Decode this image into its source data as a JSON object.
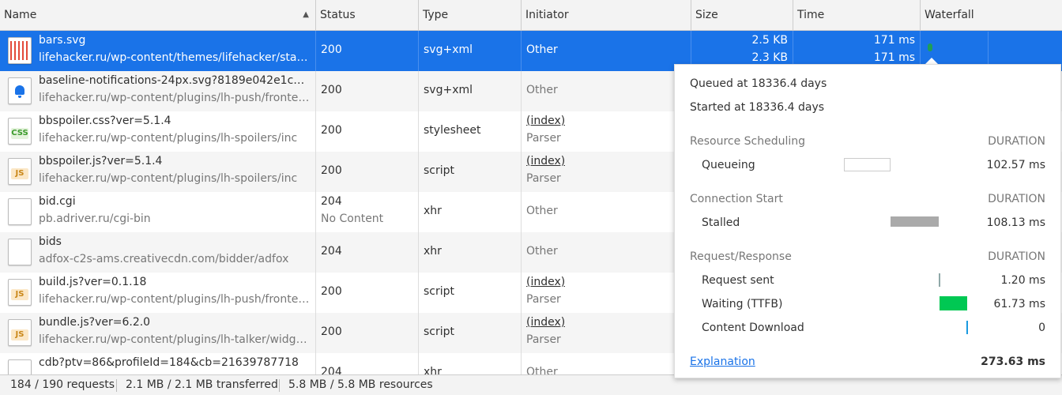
{
  "columns": {
    "name": "Name",
    "status": "Status",
    "type": "Type",
    "initiator": "Initiator",
    "size": "Size",
    "time": "Time",
    "waterfall": "Waterfall"
  },
  "rows": [
    {
      "icon": "svg-bars-icon",
      "name": "bars.svg",
      "path": "lifehacker.ru/wp-content/themes/lifehacker/static/...",
      "status": "200",
      "status_text": "",
      "type": "svg+xml",
      "initiator": "Other",
      "initiator_sub": "",
      "size": "2.5 KB",
      "size_sub": "2.3 KB",
      "time": "171 ms",
      "time_sub": "171 ms"
    },
    {
      "icon": "bell-icon",
      "name": "baseline-notifications-24px.svg?8189e042e1c0fd9...",
      "path": "lifehacker.ru/wp-content/plugins/lh-push/fronten...",
      "status": "200",
      "status_text": "",
      "type": "svg+xml",
      "initiator": "Other",
      "initiator_sub": ""
    },
    {
      "icon": "css-file-icon",
      "icon_text": "CSS",
      "name": "bbspoiler.css?ver=5.1.4",
      "path": "lifehacker.ru/wp-content/plugins/lh-spoilers/inc",
      "status": "200",
      "status_text": "",
      "type": "stylesheet",
      "initiator": "(index)",
      "initiator_sub": "Parser"
    },
    {
      "icon": "js-file-icon",
      "icon_text": "JS",
      "name": "bbspoiler.js?ver=5.1.4",
      "path": "lifehacker.ru/wp-content/plugins/lh-spoilers/inc",
      "status": "200",
      "status_text": "",
      "type": "script",
      "initiator": "(index)",
      "initiator_sub": "Parser"
    },
    {
      "icon": "blank-file-icon",
      "name": "bid.cgi",
      "path": "pb.adriver.ru/cgi-bin",
      "status": "204",
      "status_text": "No Content",
      "type": "xhr",
      "initiator": "Other",
      "initiator_sub": ""
    },
    {
      "icon": "blank-file-icon",
      "name": "bids",
      "path": "adfox-c2s-ams.creativecdn.com/bidder/adfox",
      "status": "204",
      "status_text": "",
      "type": "xhr",
      "initiator": "Other",
      "initiator_sub": ""
    },
    {
      "icon": "js-file-icon",
      "icon_text": "JS",
      "name": "build.js?ver=0.1.18",
      "path": "lifehacker.ru/wp-content/plugins/lh-push/fronten...",
      "status": "200",
      "status_text": "",
      "type": "script",
      "initiator": "(index)",
      "initiator_sub": "Parser"
    },
    {
      "icon": "js-file-icon",
      "icon_text": "JS",
      "name": "bundle.js?ver=6.2.0",
      "path": "lifehacker.ru/wp-content/plugins/lh-talker/widget/...",
      "status": "200",
      "status_text": "",
      "type": "script",
      "initiator": "(index)",
      "initiator_sub": "Parser"
    },
    {
      "icon": "blank-file-icon",
      "name": "cdb?ptv=86&profileId=184&cb=21639787718",
      "path": "",
      "status": "204",
      "status_text": "",
      "type": "xhr",
      "initiator": "Other",
      "initiator_sub": ""
    }
  ],
  "statusbar": {
    "requests": "184 / 190 requests",
    "transferred": "2.1 MB / 2.1 MB transferred",
    "resources": "5.8 MB / 5.8 MB resources"
  },
  "timing": {
    "queued": "Queued at 18336.4 days",
    "started": "Started at 18336.4 days",
    "duration_label": "DURATION",
    "sections": [
      {
        "title": "Resource Scheduling",
        "items": [
          {
            "label": "Queueing",
            "value": "102.57 ms",
            "color": "#ffffff"
          }
        ]
      },
      {
        "title": "Connection Start",
        "items": [
          {
            "label": "Stalled",
            "value": "108.13 ms",
            "color": "#aaaaaa"
          }
        ]
      },
      {
        "title": "Request/Response",
        "items": [
          {
            "label": "Request sent",
            "value": "1.20 ms",
            "color": "#8fa8a8"
          },
          {
            "label": "Waiting (TTFB)",
            "value": "61.73 ms",
            "color": "#00c853"
          },
          {
            "label": "Content Download",
            "value": "0",
            "color": "#1a9ae0"
          }
        ]
      }
    ],
    "explanation": "Explanation",
    "total": "273.63 ms"
  }
}
